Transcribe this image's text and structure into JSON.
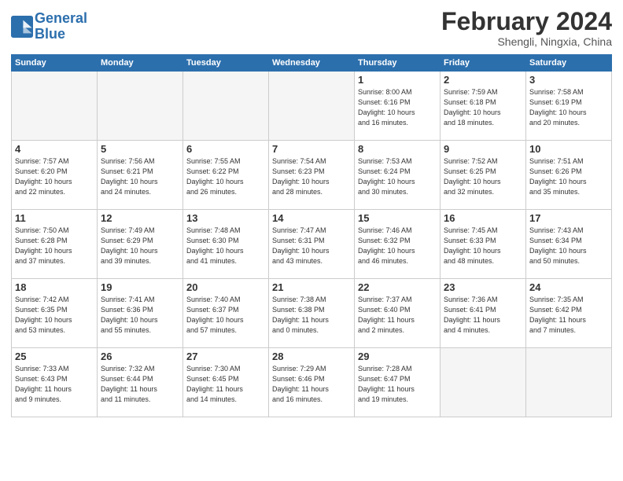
{
  "header": {
    "logo_line1": "General",
    "logo_line2": "Blue",
    "month": "February 2024",
    "location": "Shengli, Ningxia, China"
  },
  "days_of_week": [
    "Sunday",
    "Monday",
    "Tuesday",
    "Wednesday",
    "Thursday",
    "Friday",
    "Saturday"
  ],
  "weeks": [
    [
      {
        "day": "",
        "info": ""
      },
      {
        "day": "",
        "info": ""
      },
      {
        "day": "",
        "info": ""
      },
      {
        "day": "",
        "info": ""
      },
      {
        "day": "1",
        "info": "Sunrise: 8:00 AM\nSunset: 6:16 PM\nDaylight: 10 hours\nand 16 minutes."
      },
      {
        "day": "2",
        "info": "Sunrise: 7:59 AM\nSunset: 6:18 PM\nDaylight: 10 hours\nand 18 minutes."
      },
      {
        "day": "3",
        "info": "Sunrise: 7:58 AM\nSunset: 6:19 PM\nDaylight: 10 hours\nand 20 minutes."
      }
    ],
    [
      {
        "day": "4",
        "info": "Sunrise: 7:57 AM\nSunset: 6:20 PM\nDaylight: 10 hours\nand 22 minutes."
      },
      {
        "day": "5",
        "info": "Sunrise: 7:56 AM\nSunset: 6:21 PM\nDaylight: 10 hours\nand 24 minutes."
      },
      {
        "day": "6",
        "info": "Sunrise: 7:55 AM\nSunset: 6:22 PM\nDaylight: 10 hours\nand 26 minutes."
      },
      {
        "day": "7",
        "info": "Sunrise: 7:54 AM\nSunset: 6:23 PM\nDaylight: 10 hours\nand 28 minutes."
      },
      {
        "day": "8",
        "info": "Sunrise: 7:53 AM\nSunset: 6:24 PM\nDaylight: 10 hours\nand 30 minutes."
      },
      {
        "day": "9",
        "info": "Sunrise: 7:52 AM\nSunset: 6:25 PM\nDaylight: 10 hours\nand 32 minutes."
      },
      {
        "day": "10",
        "info": "Sunrise: 7:51 AM\nSunset: 6:26 PM\nDaylight: 10 hours\nand 35 minutes."
      }
    ],
    [
      {
        "day": "11",
        "info": "Sunrise: 7:50 AM\nSunset: 6:28 PM\nDaylight: 10 hours\nand 37 minutes."
      },
      {
        "day": "12",
        "info": "Sunrise: 7:49 AM\nSunset: 6:29 PM\nDaylight: 10 hours\nand 39 minutes."
      },
      {
        "day": "13",
        "info": "Sunrise: 7:48 AM\nSunset: 6:30 PM\nDaylight: 10 hours\nand 41 minutes."
      },
      {
        "day": "14",
        "info": "Sunrise: 7:47 AM\nSunset: 6:31 PM\nDaylight: 10 hours\nand 43 minutes."
      },
      {
        "day": "15",
        "info": "Sunrise: 7:46 AM\nSunset: 6:32 PM\nDaylight: 10 hours\nand 46 minutes."
      },
      {
        "day": "16",
        "info": "Sunrise: 7:45 AM\nSunset: 6:33 PM\nDaylight: 10 hours\nand 48 minutes."
      },
      {
        "day": "17",
        "info": "Sunrise: 7:43 AM\nSunset: 6:34 PM\nDaylight: 10 hours\nand 50 minutes."
      }
    ],
    [
      {
        "day": "18",
        "info": "Sunrise: 7:42 AM\nSunset: 6:35 PM\nDaylight: 10 hours\nand 53 minutes."
      },
      {
        "day": "19",
        "info": "Sunrise: 7:41 AM\nSunset: 6:36 PM\nDaylight: 10 hours\nand 55 minutes."
      },
      {
        "day": "20",
        "info": "Sunrise: 7:40 AM\nSunset: 6:37 PM\nDaylight: 10 hours\nand 57 minutes."
      },
      {
        "day": "21",
        "info": "Sunrise: 7:38 AM\nSunset: 6:38 PM\nDaylight: 11 hours\nand 0 minutes."
      },
      {
        "day": "22",
        "info": "Sunrise: 7:37 AM\nSunset: 6:40 PM\nDaylight: 11 hours\nand 2 minutes."
      },
      {
        "day": "23",
        "info": "Sunrise: 7:36 AM\nSunset: 6:41 PM\nDaylight: 11 hours\nand 4 minutes."
      },
      {
        "day": "24",
        "info": "Sunrise: 7:35 AM\nSunset: 6:42 PM\nDaylight: 11 hours\nand 7 minutes."
      }
    ],
    [
      {
        "day": "25",
        "info": "Sunrise: 7:33 AM\nSunset: 6:43 PM\nDaylight: 11 hours\nand 9 minutes."
      },
      {
        "day": "26",
        "info": "Sunrise: 7:32 AM\nSunset: 6:44 PM\nDaylight: 11 hours\nand 11 minutes."
      },
      {
        "day": "27",
        "info": "Sunrise: 7:30 AM\nSunset: 6:45 PM\nDaylight: 11 hours\nand 14 minutes."
      },
      {
        "day": "28",
        "info": "Sunrise: 7:29 AM\nSunset: 6:46 PM\nDaylight: 11 hours\nand 16 minutes."
      },
      {
        "day": "29",
        "info": "Sunrise: 7:28 AM\nSunset: 6:47 PM\nDaylight: 11 hours\nand 19 minutes."
      },
      {
        "day": "",
        "info": ""
      },
      {
        "day": "",
        "info": ""
      }
    ]
  ]
}
